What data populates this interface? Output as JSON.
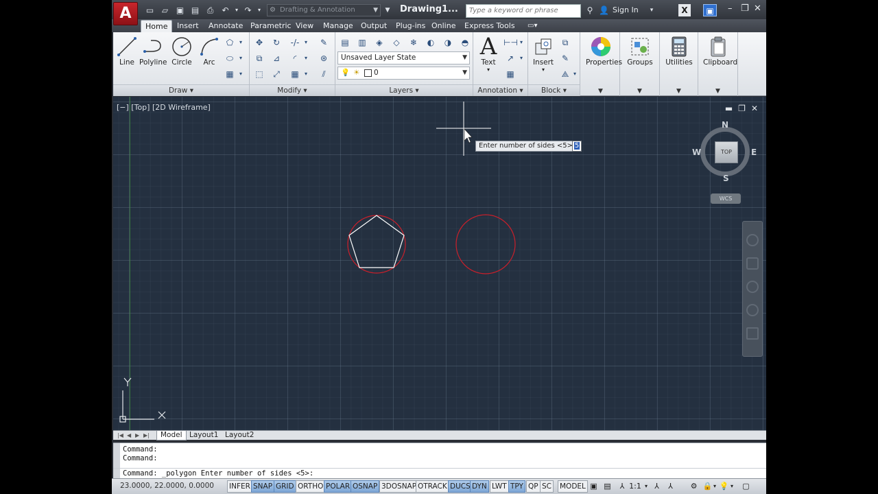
{
  "app": {
    "logo_letter": "A",
    "title": "Drawing1...",
    "workspace": "Drafting & Annotation",
    "search_placeholder": "Type a keyword or phrase",
    "sign_in": "Sign In"
  },
  "ribbon_tabs": [
    {
      "label": "Home",
      "active": true
    },
    {
      "label": "Insert"
    },
    {
      "label": "Annotate"
    },
    {
      "label": "Parametric"
    },
    {
      "label": "View"
    },
    {
      "label": "Manage"
    },
    {
      "label": "Output"
    },
    {
      "label": "Plug-ins"
    },
    {
      "label": "Online"
    },
    {
      "label": "Express Tools"
    }
  ],
  "panels": {
    "draw": {
      "label": "Draw",
      "tools": [
        "Line",
        "Polyline",
        "Circle",
        "Arc"
      ]
    },
    "modify": {
      "label": "Modify"
    },
    "layers": {
      "label": "Layers",
      "layer_state": "Unsaved Layer State",
      "current_layer": "0"
    },
    "annotation": {
      "label": "Annotation",
      "text_tool": "Text"
    },
    "block": {
      "label": "Block",
      "insert_tool": "Insert"
    },
    "properties": {
      "label": "Properties"
    },
    "groups": {
      "label": "Groups"
    },
    "utilities": {
      "label": "Utilities"
    },
    "clipboard": {
      "label": "Clipboard"
    }
  },
  "viewport": {
    "label": "[−] [Top] [2D Wireframe]",
    "tooltip_prompt": "Enter number of sides <5>:",
    "tooltip_value": "5",
    "viewcube": {
      "north": "N",
      "south": "S",
      "east": "E",
      "west": "W",
      "face": "TOP"
    },
    "wcs_label": "WCS",
    "ucs_x": "X",
    "ucs_y": "Y",
    "colors": {
      "circle": "#cc1f2a",
      "polygon": "#ffffff",
      "crosshair": "#ffffff"
    }
  },
  "layout_tabs": [
    {
      "label": "Model",
      "active": true
    },
    {
      "label": "Layout1"
    },
    {
      "label": "Layout2"
    }
  ],
  "command": {
    "history": [
      "Command:",
      "Command:"
    ],
    "current": "Command:  _polygon Enter number of sides <5>:"
  },
  "status": {
    "coords": "23.0000, 22.0000, 0.0000",
    "toggles": [
      {
        "label": "INFER",
        "on": false
      },
      {
        "label": "SNAP",
        "on": true
      },
      {
        "label": "GRID",
        "on": true
      },
      {
        "label": "ORTHO",
        "on": false
      },
      {
        "label": "POLAR",
        "on": true
      },
      {
        "label": "OSNAP",
        "on": true
      },
      {
        "label": "3DOSNAP",
        "on": false
      },
      {
        "label": "OTRACK",
        "on": false
      },
      {
        "label": "DUCS",
        "on": true
      },
      {
        "label": "DYN",
        "on": true
      },
      {
        "label": "LWT",
        "on": false
      },
      {
        "label": "TPY",
        "on": true
      },
      {
        "label": "QP",
        "on": false
      },
      {
        "label": "SC",
        "on": false
      }
    ],
    "model_label": "MODEL",
    "scale": "1:1"
  }
}
